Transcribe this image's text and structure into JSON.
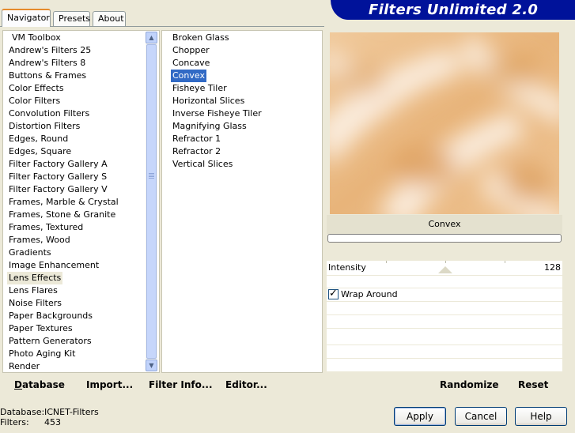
{
  "tabs": [
    {
      "label": "Navigator",
      "active": true
    },
    {
      "label": "Presets",
      "active": false
    },
    {
      "label": "About",
      "active": false
    }
  ],
  "banner": {
    "title": "Filters Unlimited 2.0"
  },
  "categories": [
    "VM Toolbox",
    "Andrew's Filters 25",
    "Andrew's Filters 8",
    "Buttons & Frames",
    "Color Effects",
    "Color Filters",
    "Convolution Filters",
    "Distortion Filters",
    "Edges, Round",
    "Edges, Square",
    "Filter Factory Gallery A",
    "Filter Factory Gallery S",
    "Filter Factory Gallery V",
    "Frames, Marble & Crystal",
    "Frames, Stone & Granite",
    "Frames, Textured",
    "Frames, Wood",
    "Gradients",
    "Image Enhancement",
    "Lens Effects",
    "Lens Flares",
    "Noise Filters",
    "Paper Backgrounds",
    "Paper Textures",
    "Pattern Generators",
    "Photo Aging Kit",
    "Render"
  ],
  "highlighted_category": "Lens Effects",
  "filters": [
    "Broken Glass",
    "Chopper",
    "Concave",
    "Convex",
    "Fisheye Tiler",
    "Horizontal Slices",
    "Inverse Fisheye Tiler",
    "Magnifying Glass",
    "Refractor 1",
    "Refractor 2",
    "Vertical Slices"
  ],
  "selected_filter": "Convex",
  "left_buttons": {
    "database": {
      "label": "Database",
      "mnemonic": "D"
    },
    "import": {
      "label": "Import...",
      "mnemonic": "I"
    },
    "filter_info": {
      "label": "Filter Info...",
      "mnemonic": "I"
    },
    "editor": {
      "label": "Editor...",
      "mnemonic": "E"
    }
  },
  "preview": {
    "filter_name": "Convex",
    "progress": 0
  },
  "parameters": {
    "intensity": {
      "label": "Intensity",
      "value": "128",
      "max": 255
    },
    "wrap_around": {
      "label": "Wrap Around",
      "checked": true,
      "check_glyph": "✓"
    }
  },
  "right_buttons": {
    "randomize": {
      "label": "Randomize",
      "mnemonic": "R"
    },
    "reset": {
      "label": "Reset",
      "mnemonic": "R"
    }
  },
  "footer": {
    "database_label": "Database:",
    "database_value": "ICNET-Filters",
    "filters_label": "Filters:",
    "filters_value": "453"
  },
  "dialog_buttons": {
    "apply": "Apply",
    "cancel": "Cancel",
    "help": "Help"
  },
  "scrollbar": {
    "up_glyph": "▲",
    "down_glyph": "▼"
  },
  "colors": {
    "banner": "#00129a",
    "selection": "#316ac5",
    "tab_accent": "#e68b2c",
    "preview_peach": "#e2a96b",
    "preview_cream": "#fbeee0"
  }
}
